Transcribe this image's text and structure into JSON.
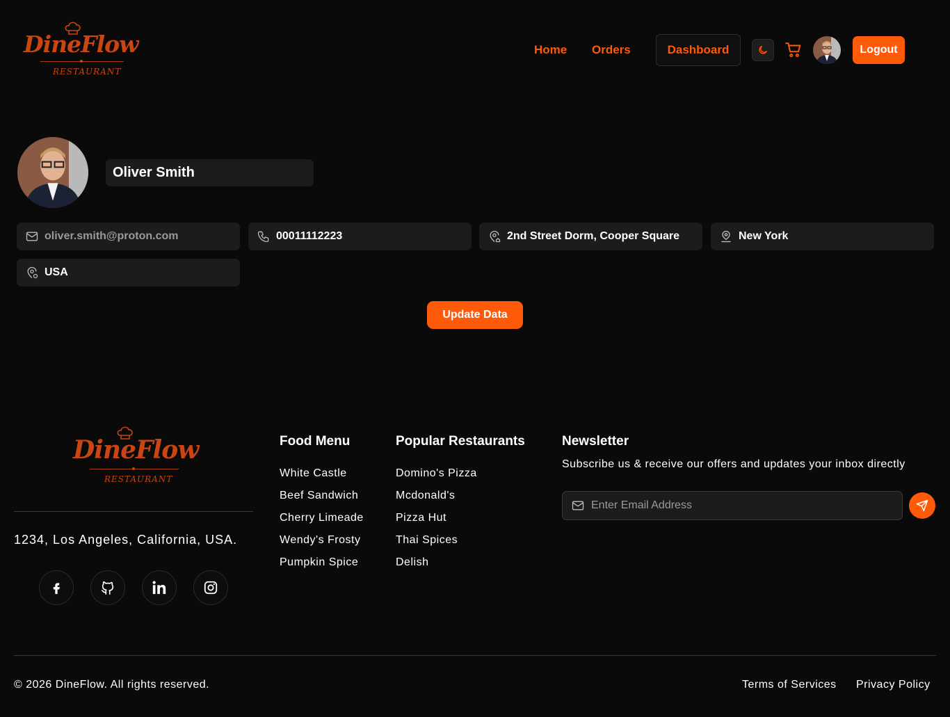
{
  "brand": {
    "name": "DineFlow",
    "tagline": "RESTAURANT",
    "accent_color": "#ff5a0a"
  },
  "nav": {
    "links": [
      "Home",
      "Orders"
    ],
    "dashboard": "Dashboard",
    "theme_icon": "moon-icon",
    "cart_icon": "cart-icon",
    "logout": "Logout"
  },
  "profile": {
    "name": "Oliver Smith",
    "email": "oliver.smith@proton.com",
    "phone": "00011112223",
    "address": "2nd Street Dorm, Cooper Square",
    "city": "New York",
    "country": "USA",
    "update_button": "Update Data"
  },
  "footer": {
    "address": "1234, Los Angeles, California, USA.",
    "social_icons": [
      "facebook-icon",
      "github-icon",
      "linkedin-icon",
      "instagram-icon"
    ],
    "food_menu": {
      "title": "Food Menu",
      "items": [
        "White Castle",
        "Beef Sandwich",
        "Cherry Limeade",
        "Wendy's Frosty",
        "Pumpkin Spice"
      ]
    },
    "popular_restaurants": {
      "title": "Popular Restaurants",
      "items": [
        "Domino's Pizza",
        "Mcdonald's",
        "Pizza Hut",
        "Thai Spices",
        "Delish"
      ]
    },
    "newsletter": {
      "title": "Newsletter",
      "description": "Subscribe us & receive our offers and updates your inbox directly",
      "placeholder": "Enter Email Address"
    },
    "copyright": "© 2026 DineFlow. All rights reserved.",
    "terms": "Terms of Services",
    "privacy": "Privacy Policy"
  }
}
